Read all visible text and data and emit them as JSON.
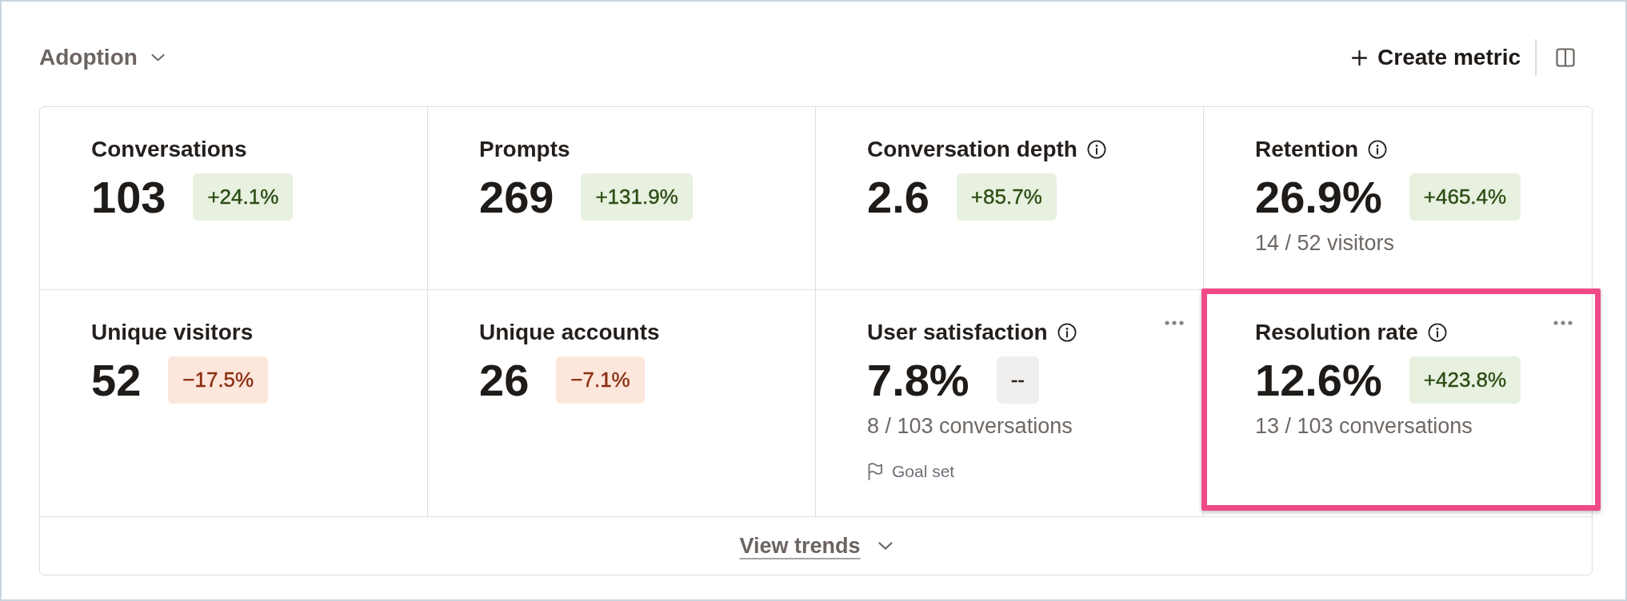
{
  "header": {
    "title": "Adoption",
    "create_button": "Create metric"
  },
  "metrics": [
    {
      "title": "Conversations",
      "info": false,
      "menu": false,
      "highlighted": false,
      "value": "103",
      "change": "+24.1%",
      "kind": "gain"
    },
    {
      "title": "Prompts",
      "info": false,
      "menu": false,
      "highlighted": false,
      "value": "269",
      "change": "+131.9%",
      "kind": "gain"
    },
    {
      "title": "Conversation depth",
      "info": true,
      "menu": false,
      "highlighted": false,
      "value": "2.6",
      "change": "+85.7%",
      "kind": "gain"
    },
    {
      "title": "Retention",
      "info": true,
      "menu": false,
      "highlighted": false,
      "value": "26.9%",
      "change": "+465.4%",
      "kind": "gain",
      "detail": "14 / 52 visitors"
    },
    {
      "title": "Unique visitors",
      "info": false,
      "menu": false,
      "highlighted": false,
      "value": "52",
      "change": "−17.5%",
      "kind": "loss"
    },
    {
      "title": "Unique accounts",
      "info": false,
      "menu": false,
      "highlighted": false,
      "value": "26",
      "change": "−7.1%",
      "kind": "loss"
    },
    {
      "title": "User satisfaction",
      "info": true,
      "menu": true,
      "highlighted": false,
      "value": "7.8%",
      "change": "--",
      "kind": "flat",
      "detail": "8 / 103 conversations",
      "goal": "Goal set"
    },
    {
      "title": "Resolution rate",
      "info": true,
      "menu": true,
      "highlighted": true,
      "value": "12.6%",
      "change": "+423.8%",
      "kind": "gain",
      "detail": "13 / 103 conversations"
    }
  ],
  "footer": {
    "link": "View trends"
  }
}
